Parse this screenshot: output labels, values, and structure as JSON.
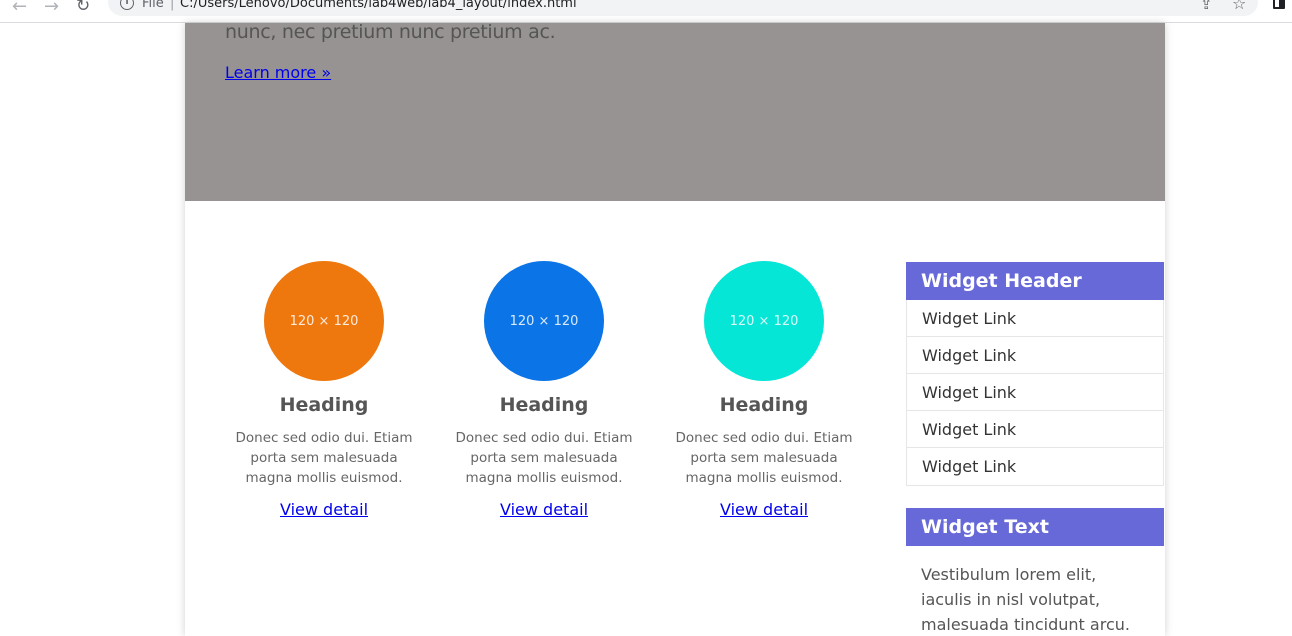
{
  "browser": {
    "file_label": "File",
    "url": "C:/Users/Lenovo/Documents/lab4web/lab4_layout/index.html"
  },
  "hero": {
    "text": "nunc, nec pretium nunc pretium ac.",
    "link": "Learn more »"
  },
  "features": [
    {
      "placeholder": "120 × 120",
      "color": "#ee780e",
      "heading": "Heading",
      "text": "Donec sed odio dui. Etiam porta sem malesuada magna mollis euismod.",
      "link": "View detail"
    },
    {
      "placeholder": "120 × 120",
      "color": "#0b74e6",
      "heading": "Heading",
      "text": "Donec sed odio dui. Etiam porta sem malesuada magna mollis euismod.",
      "link": "View detail"
    },
    {
      "placeholder": "120 × 120",
      "color": "#05e6d6",
      "heading": "Heading",
      "text": "Donec sed odio dui. Etiam porta sem malesuada magna mollis euismod.",
      "link": "View detail"
    }
  ],
  "widget_links": {
    "header": "Widget Header",
    "links": [
      "Widget Link",
      "Widget Link",
      "Widget Link",
      "Widget Link",
      "Widget Link"
    ]
  },
  "widget_text": {
    "header": "Widget Text",
    "body": "Vestibulum lorem elit, iaculis in nisl volutpat, malesuada tincidunt arcu. Proin in leo"
  },
  "colors": {
    "hero_bg": "#969392",
    "widget_header_bg": "#6669d7",
    "link": "#0000ee"
  }
}
